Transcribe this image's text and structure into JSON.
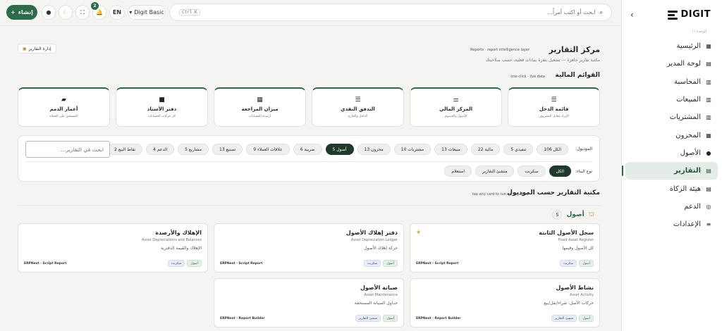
{
  "sidebar": {
    "logo_text": "DIGIT",
    "section_label": "الوحدة ١١",
    "items": [
      {
        "label": "الرئيسية",
        "icon": "dashboard-icon",
        "glyph": "▦"
      },
      {
        "label": "لوحة المدير",
        "icon": "manager-board-icon",
        "glyph": "▤"
      },
      {
        "label": "المحاسبة",
        "icon": "ledger-icon",
        "glyph": "▥"
      },
      {
        "label": "المبيعات",
        "icon": "sales-icon",
        "glyph": "▥"
      },
      {
        "label": "المشتريات",
        "icon": "purchases-icon",
        "glyph": "▥"
      },
      {
        "label": "المخزون",
        "icon": "inventory-icon",
        "glyph": "▦"
      },
      {
        "label": "الأصول",
        "icon": "person-icon",
        "glyph": "●"
      },
      {
        "label": "التقارير",
        "icon": "reports-icon",
        "glyph": "▤"
      },
      {
        "label": "هيئة الزكاة",
        "icon": "tax-icon",
        "glyph": "▤"
      },
      {
        "label": "الدعم",
        "icon": "support-icon",
        "glyph": "◎"
      },
      {
        "label": "الإعدادات",
        "icon": "settings-icon",
        "glyph": "≡"
      }
    ],
    "active_index": 7
  },
  "topbar": {
    "create_label": "إنشاء",
    "notif_count": "2",
    "company_label": "Digit Basic",
    "lang_label": "EN",
    "search_placeholder": "ابحث أو اكتب أمراً...",
    "search_shortcut": "Ctrl K"
  },
  "page": {
    "title": "مركز التقارير",
    "subtitle_en": "Reports · report intelligence layer",
    "subtitle": "مكتبة تقارير جاهزة — تشغيل بنقرة ببيانات فعلية، حسب صلاحيتك",
    "manage_label": "إدارة التقارير"
  },
  "financial": {
    "title": "القوائم المالية",
    "hint": "one-click · live data",
    "cards": [
      {
        "title": "قائمة الدخل",
        "sub": "الإيراد مقابل المصروف",
        "glyph": "☰"
      },
      {
        "title": "المركز المالي",
        "sub": "الأصول والخصوم",
        "glyph": "⚌"
      },
      {
        "title": "التدفق النقدي",
        "sub": "الداخل والخارج",
        "glyph": "☰"
      },
      {
        "title": "ميزان المراجعة",
        "sub": "أرصدة الحسابات",
        "glyph": "▦"
      },
      {
        "title": "دفتر الأستاذ",
        "sub": "كل حركات الحسابات",
        "glyph": "■"
      },
      {
        "title": "أعمار الذمم",
        "sub": "المستحق على العملاء",
        "glyph": "▰"
      }
    ]
  },
  "filters": {
    "module_label": "الموديول:",
    "modules": [
      {
        "label": "الكل 106",
        "active": false
      },
      {
        "label": "تنفيذي 5",
        "active": false
      },
      {
        "label": "مالية 22",
        "active": false
      },
      {
        "label": "مبيعات 13",
        "active": false
      },
      {
        "label": "مشتريات 10",
        "active": false
      },
      {
        "label": "مخزون 13",
        "active": false
      },
      {
        "label": "أصول 5",
        "active": true
      },
      {
        "label": "ضريبة 6",
        "active": false
      },
      {
        "label": "علاقات العملاء 9",
        "active": false
      },
      {
        "label": "تصنيع 13",
        "active": false
      },
      {
        "label": "مشاريع 5",
        "active": false
      },
      {
        "label": "الدعم 4",
        "active": false
      },
      {
        "label": "نقاط البيع 2",
        "active": false
      }
    ],
    "build_label": "نوع البناء:",
    "builds": [
      {
        "label": "الكل",
        "active": true
      },
      {
        "label": "سكربت",
        "active": false
      },
      {
        "label": "منشئ التقارير",
        "active": false
      },
      {
        "label": "استعلام",
        "active": false
      }
    ],
    "search_placeholder": "ابحث في التقارير..."
  },
  "library": {
    "title": "مكتبة التقارير حسب الموديول",
    "hint": "tap any card to run on live data",
    "group_name": "أصول",
    "group_count": "5",
    "cards": [
      {
        "title": "سجل الأصول الثابتة",
        "en": "Fixed Asset Register",
        "desc": "كل الأصول وقيمها",
        "tags": [
          "أصول",
          "سكربت"
        ],
        "source": "ERPNext · Script Report",
        "starred": true
      },
      {
        "title": "دفتر إهلاك الأصول",
        "en": "Asset Depreciation Ledger",
        "desc": "حركة إهلاك الأصول",
        "tags": [
          "أصول",
          "سكربت"
        ],
        "source": "ERPNext · Script Report",
        "starred": false
      },
      {
        "title": "الإهلاك والأرصدة",
        "en": "Asset Depreciations and Balances",
        "desc": "الإهلاك والقيمة الدفترية",
        "tags": [
          "أصول",
          "سكربت"
        ],
        "source": "ERPNext · Script Report",
        "starred": false
      },
      {
        "title": "نشاط الأصول",
        "en": "Asset Activity",
        "desc": "حركات الأصل: شراء/نقل/بيع",
        "tags": [
          "أصول",
          "منشئ التقارير"
        ],
        "source": "ERPNext · Report Builder",
        "starred": false
      },
      {
        "title": "صيانة الأصول",
        "en": "Asset Maintenance",
        "desc": "جداول الصيانة المستحقة",
        "tags": [
          "أصول",
          "منشئ التقارير"
        ],
        "source": "ERPNext · Report Builder",
        "starred": false
      }
    ]
  },
  "colors": {
    "accent": "#2c6b47",
    "active_nav_bg": "#e3ece6",
    "active_chip": "#1f3a2a"
  }
}
